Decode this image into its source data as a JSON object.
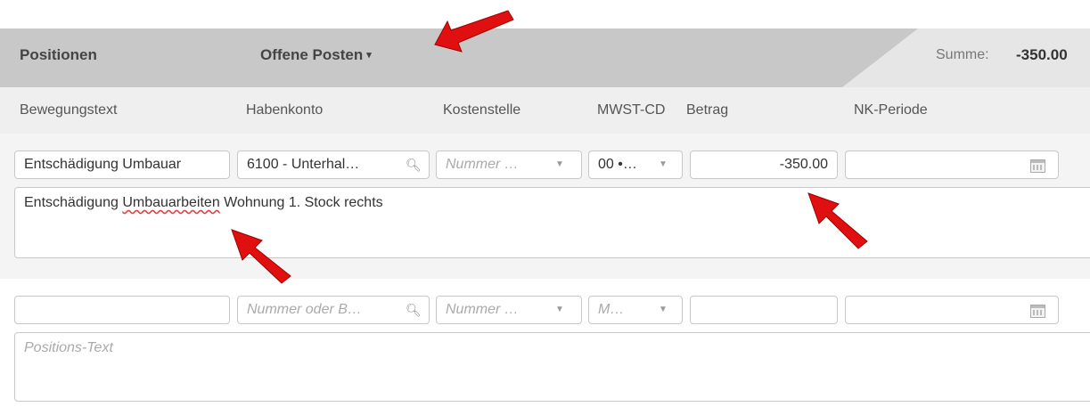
{
  "header": {
    "title": "Positionen",
    "dropdown_label": "Offene Posten",
    "dropdown_caret": "▾",
    "sum_label": "Summe:",
    "sum_value": "-350.00"
  },
  "columns": [
    "Bewegungstext",
    "Habenkonto",
    "Kostenstelle",
    "MWST-CD",
    "Betrag",
    "NK-Periode"
  ],
  "row1": {
    "bewegungstext": "Entschädigung Umbauar",
    "habenkonto": "6100 - Unterhal…",
    "kostenstelle_placeholder": "Nummer …",
    "mwst": "00 •…",
    "betrag": "-350.00",
    "nk_periode": "",
    "text_before": "Entschädigung ",
    "text_underlined": "Umbauarbeiten",
    "text_after": " Wohnung 1. Stock rechts"
  },
  "row2": {
    "bewegungstext": "",
    "habenkonto_placeholder": "Nummer oder B…",
    "kostenstelle_placeholder": "Nummer …",
    "mwst_placeholder": "M…",
    "betrag": "",
    "nk_periode": "",
    "text_placeholder": "Positions-Text"
  },
  "icons": {
    "search": "search-icon",
    "dropdown": "chevron-down-icon",
    "calendar": "calendar-icon",
    "arrow": "red-arrow-annotation"
  },
  "colors": {
    "arrow": "#e01010",
    "header_bg": "#c8c8c8"
  }
}
